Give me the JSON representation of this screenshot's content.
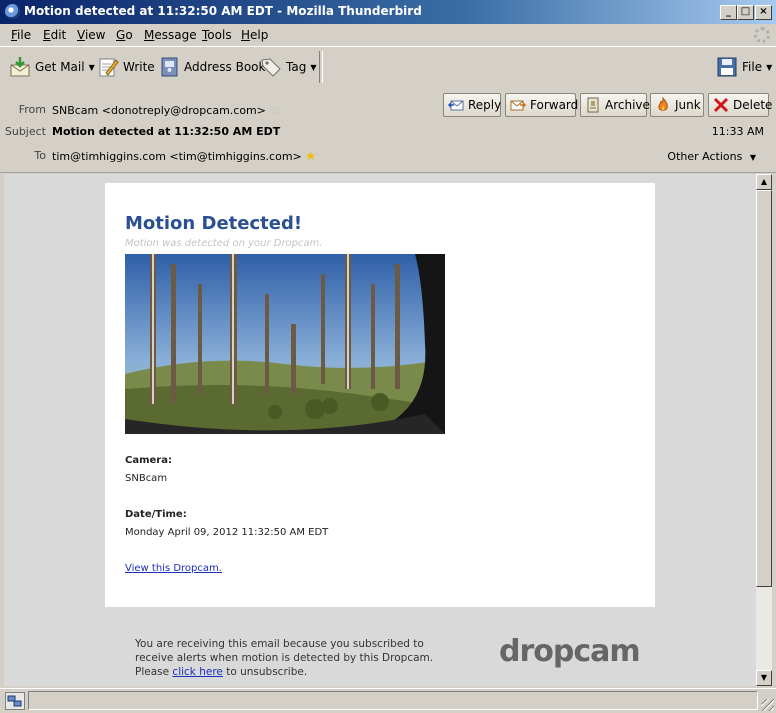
{
  "window": {
    "title": "Motion detected at 11:32:50 AM EDT - Mozilla Thunderbird",
    "controls": [
      "_",
      "□",
      "×"
    ]
  },
  "menubar": {
    "items": [
      {
        "label": "File",
        "accel": "F"
      },
      {
        "label": "Edit",
        "accel": "E"
      },
      {
        "label": "View",
        "accel": "V"
      },
      {
        "label": "Go",
        "accel": "G"
      },
      {
        "label": "Message",
        "accel": "M"
      },
      {
        "label": "Tools",
        "accel": "T"
      },
      {
        "label": "Help",
        "accel": "H"
      }
    ]
  },
  "toolbar": {
    "get_mail": "Get Mail",
    "write": "Write",
    "address_book": "Address Book",
    "tag": "Tag",
    "file": "File"
  },
  "header": {
    "from_label": "From",
    "from_value": "SNBcam <donotreply@dropcam.com>",
    "subject_label": "Subject",
    "subject_value": "Motion detected at 11:32:50 AM EDT",
    "to_label": "To",
    "to_value": "tim@timhiggins.com <tim@timhiggins.com>",
    "time": "11:33 AM",
    "other_actions": "Other Actions",
    "buttons": {
      "reply": "Reply",
      "forward": "Forward",
      "archive": "Archive",
      "junk": "Junk",
      "delete": "Delete"
    }
  },
  "message": {
    "heading": "Motion Detected!",
    "subheading": "Motion was detected on your Dropcam.",
    "camera_label": "Camera:",
    "camera_value": "SNBcam",
    "datetime_label": "Date/Time:",
    "datetime_value": "Monday April 09, 2012 11:32:50 AM EDT",
    "view_link": "View this Dropcam.",
    "footer_line1": "You are receiving this email because you subscribed to receive alerts when motion is detected by this Dropcam.",
    "footer_please": "Please",
    "footer_link": "click here",
    "footer_end": "to unsubscribe.",
    "logo_text": "dropcam"
  },
  "colors": {
    "title_bar": "#0a246a",
    "heading_blue": "#2a4f93",
    "link_blue": "#1a2fbb",
    "junk_flame": "#f08020",
    "delete_red": "#d01818"
  }
}
